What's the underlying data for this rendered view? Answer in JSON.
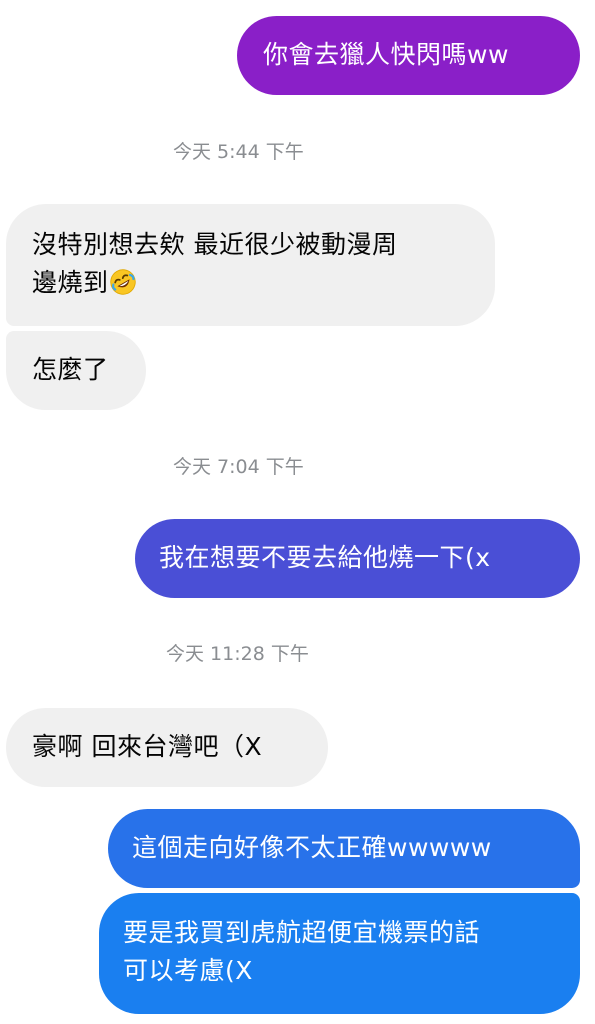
{
  "conversation": {
    "messages": [
      {
        "id": "m1",
        "from": "me",
        "text": "你會去獵人快閃嗎ww",
        "color": "#8a1fc8"
      },
      {
        "id": "ts1",
        "type": "timestamp",
        "text": "今天 5:44 下午"
      },
      {
        "id": "m2",
        "from": "them",
        "line1": "沒特別想去欸 最近很少被動漫周",
        "line2": "邊燒到",
        "emoji": "rolling-on-floor-laughing-emoji"
      },
      {
        "id": "m3",
        "from": "them",
        "text": "怎麼了"
      },
      {
        "id": "ts2",
        "type": "timestamp",
        "text": "今天 7:04 下午"
      },
      {
        "id": "m4",
        "from": "me",
        "text": "我在想要不要去給他燒一下(x",
        "color": "#4a4fd6"
      },
      {
        "id": "ts3",
        "type": "timestamp",
        "text": "今天 11:28 下午"
      },
      {
        "id": "m5",
        "from": "them",
        "text": "豪啊 回來台灣吧（X"
      },
      {
        "id": "m6",
        "from": "me",
        "text": "這個走向好像不太正確wwwww",
        "color": "#2872ea"
      },
      {
        "id": "m7",
        "from": "me",
        "line1": "要是我買到虎航超便宜機票的話",
        "line2": "可以考慮(X",
        "color": "#1a7ff0"
      }
    ]
  }
}
